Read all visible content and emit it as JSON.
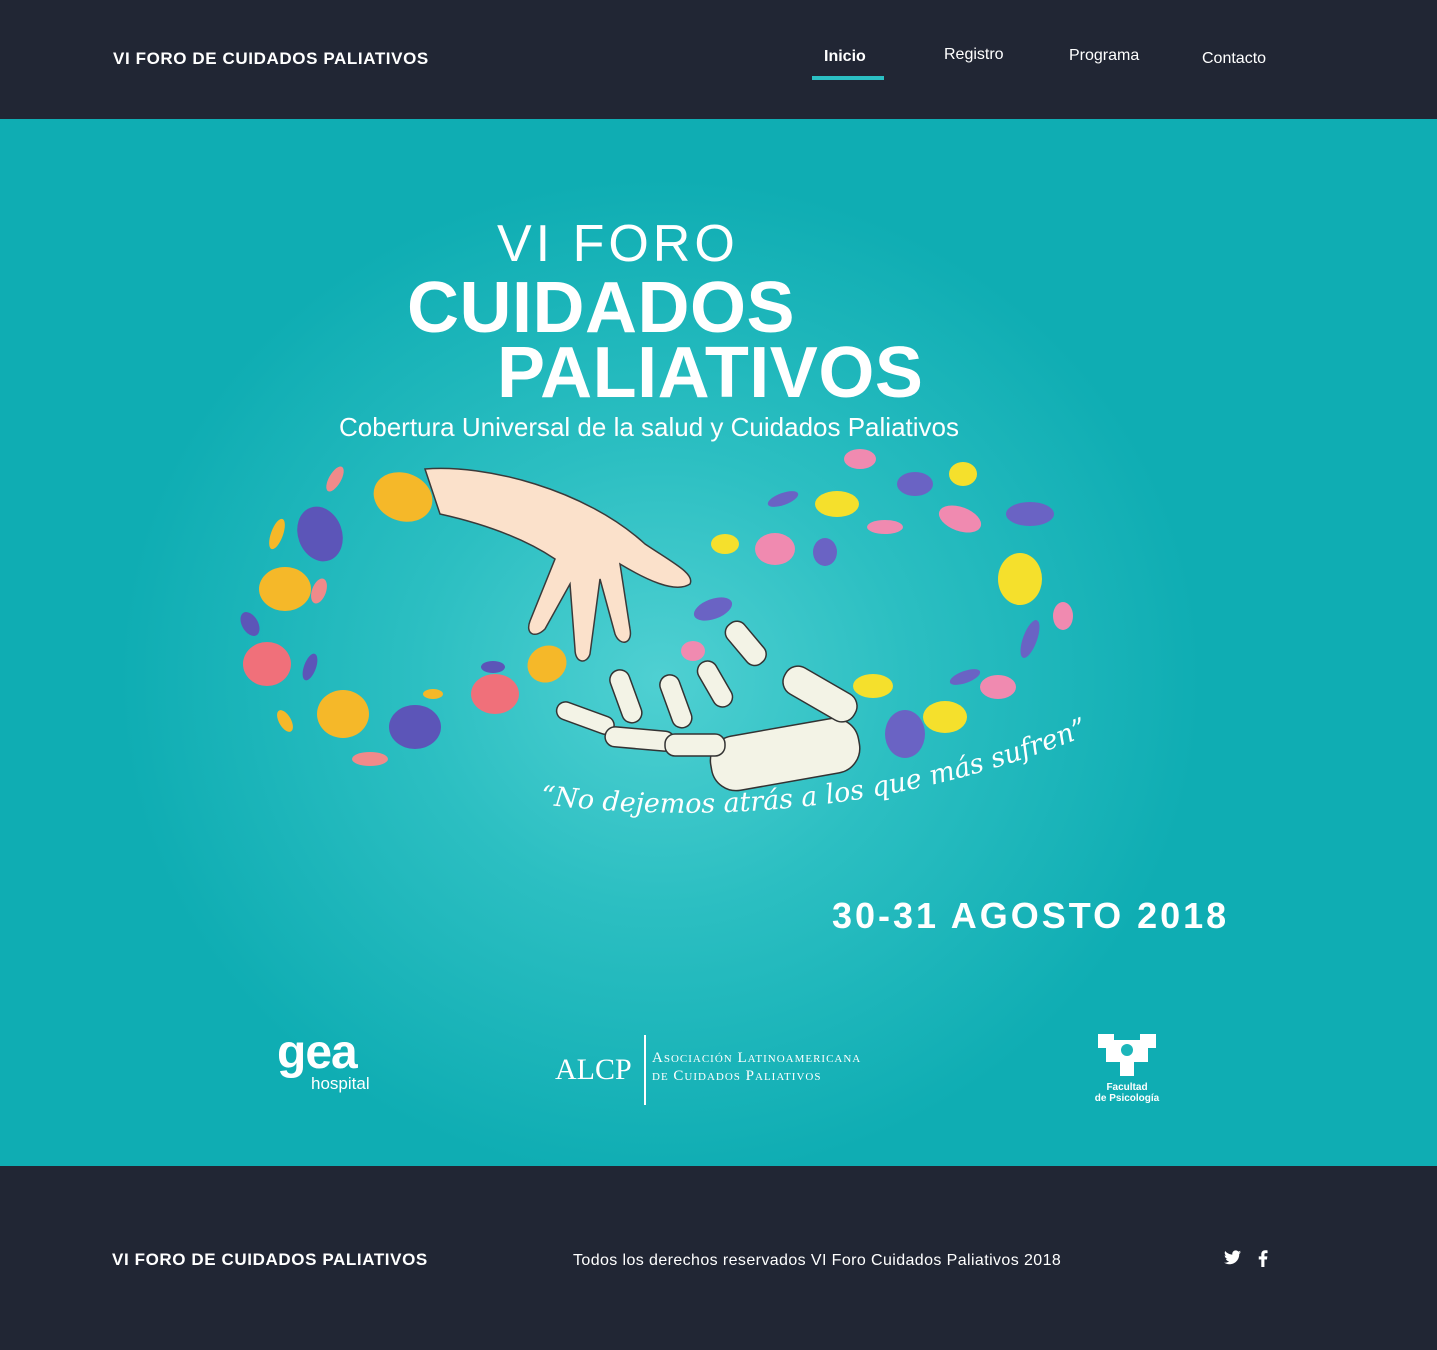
{
  "header": {
    "site_title": "VI FORO DE CUIDADOS PALIATIVOS",
    "nav": [
      {
        "label": "Inicio",
        "active": true
      },
      {
        "label": "Registro",
        "active": false
      },
      {
        "label": "Programa",
        "active": false
      },
      {
        "label": "Contacto",
        "active": false
      }
    ]
  },
  "hero": {
    "title_line1": "VI FORO",
    "title_line2": "CUIDADOS",
    "title_line3": "PALIATIVOS",
    "subtitle": "Cobertura Universal de la salud y Cuidados Paliativos",
    "quote": "“No dejemos atrás a los que más sufren”.",
    "date": "30-31 AGOSTO 2018",
    "background_color": "#1cb6ba",
    "sponsors": {
      "gea": {
        "word": "gea",
        "sub": "hospital"
      },
      "alcp": {
        "abbr": "ALCP",
        "name_line1": "Asociación Latinoamericana",
        "name_line2": "de Cuidados Paliativos"
      },
      "psicologia": {
        "line1": "Facultad",
        "line2": "de Psicología"
      }
    }
  },
  "footer": {
    "site_title": "VI FORO DE CUIDADOS PALIATIVOS",
    "copyright": "Todos los derechos reservados VI Foro Cuidados Paliativos 2018",
    "social": [
      "twitter-icon",
      "facebook-icon"
    ],
    "background_color": "#212634"
  }
}
